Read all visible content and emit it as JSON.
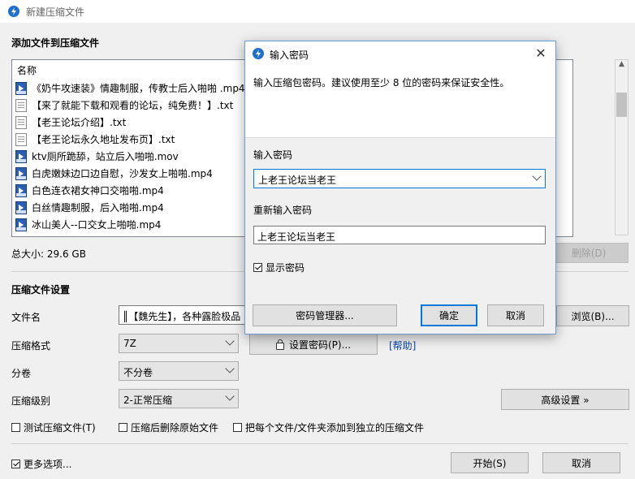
{
  "window": {
    "title": "新建压缩文件"
  },
  "files_section": {
    "heading": "添加文件到压缩文件",
    "column_name": "名称",
    "files": [
      {
        "name": "《奶牛攻速装》情趣制服，传教士后入啪啪 .mp4",
        "icon": "video-file-icon"
      },
      {
        "name": "【来了就能下载和观看的论坛，纯免费！】.txt",
        "icon": "text-file-icon"
      },
      {
        "name": "【老王论坛介绍】.txt",
        "icon": "text-file-icon"
      },
      {
        "name": "【老王论坛永久地址发布页】.txt",
        "icon": "text-file-icon"
      },
      {
        "name": "ktv厕所跪舔，站立后入啪啪.mov",
        "icon": "video-file-icon"
      },
      {
        "name": "白虎嫩妹边口边自慰，沙发女上啪啪.mp4",
        "icon": "video-file-icon"
      },
      {
        "name": "白色连衣裙女神口交啪啪.mp4",
        "icon": "video-file-icon"
      },
      {
        "name": "白丝情趣制服，后入啪啪.mp4",
        "icon": "video-file-icon"
      },
      {
        "name": "冰山美人--口交女上啪啪.mp4",
        "icon": "video-file-icon"
      }
    ],
    "total_size": "总大小: 29.6 GB",
    "delete_button": "删除(D)"
  },
  "settings": {
    "heading": "压缩文件设置",
    "filename_label": "文件名",
    "filename_value": "║【魏先生】，各种露脸极品",
    "browse_button": "浏览(B)...",
    "format_label": "压缩格式",
    "format_value": "7Z",
    "set_password_button": "设置密码(P)...",
    "help_link": "[帮助]",
    "split_label": "分卷",
    "split_value": "不分卷",
    "level_label": "压缩级别",
    "level_value": "2-正常压缩",
    "advanced_button": "高级设置 »",
    "test_checkbox": "测试压缩文件(T)",
    "delete_after_checkbox": "压缩后删除原始文件",
    "separate_checkbox": "把每个文件/文件夹添加到独立的压缩文件",
    "more_options_checkbox": "更多选项...",
    "start_button": "开始(S)",
    "cancel_button": "取消"
  },
  "password_dialog": {
    "title": "输入密码",
    "description": "输入压缩包密码。建议使用至少 8 位的密码来保证安全性。",
    "password_label": "输入密码",
    "password_value": "上老王论坛当老王",
    "reenter_label": "重新输入密码",
    "reenter_value": "上老王论坛当老王",
    "show_password_label": "显示密码",
    "show_password_checked": true,
    "manager_button": "密码管理器...",
    "ok_button": "确定",
    "cancel_button": "取消"
  }
}
